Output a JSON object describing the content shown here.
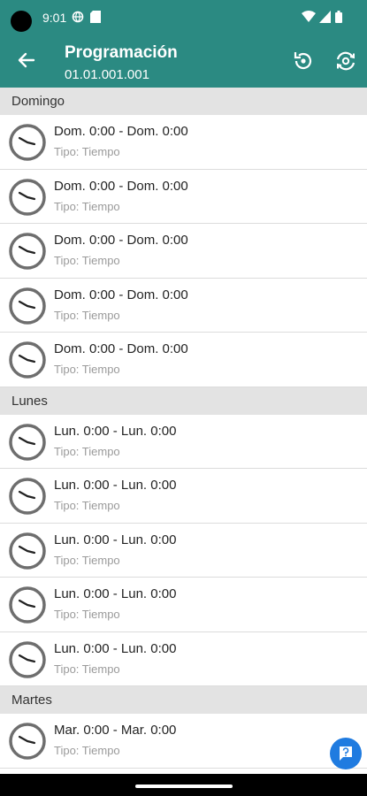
{
  "status": {
    "time": "9:01"
  },
  "header": {
    "title": "Programación",
    "subtitle": "01.01.001.001"
  },
  "sections": [
    {
      "name": "Domingo",
      "items": [
        {
          "range": "Dom. 0:00 - Dom. 0:00",
          "type": "Tipo: Tiempo"
        },
        {
          "range": "Dom. 0:00 - Dom. 0:00",
          "type": "Tipo: Tiempo"
        },
        {
          "range": "Dom. 0:00 - Dom. 0:00",
          "type": "Tipo: Tiempo"
        },
        {
          "range": "Dom. 0:00 - Dom. 0:00",
          "type": "Tipo: Tiempo"
        },
        {
          "range": "Dom. 0:00 - Dom. 0:00",
          "type": "Tipo: Tiempo"
        }
      ]
    },
    {
      "name": "Lunes",
      "items": [
        {
          "range": "Lun. 0:00 - Lun. 0:00",
          "type": "Tipo: Tiempo"
        },
        {
          "range": "Lun. 0:00 - Lun. 0:00",
          "type": "Tipo: Tiempo"
        },
        {
          "range": "Lun. 0:00 - Lun. 0:00",
          "type": "Tipo: Tiempo"
        },
        {
          "range": "Lun. 0:00 - Lun. 0:00",
          "type": "Tipo: Tiempo"
        },
        {
          "range": "Lun. 0:00 - Lun. 0:00",
          "type": "Tipo: Tiempo"
        }
      ]
    },
    {
      "name": "Martes",
      "items": [
        {
          "range": "Mar. 0:00 - Mar. 0:00",
          "type": "Tipo: Tiempo"
        }
      ]
    }
  ],
  "fab": {
    "icon": "help-icon"
  },
  "colors": {
    "appbar": "#2b8a82",
    "fab": "#1f7be0",
    "section_bg": "#e3e3e3"
  }
}
